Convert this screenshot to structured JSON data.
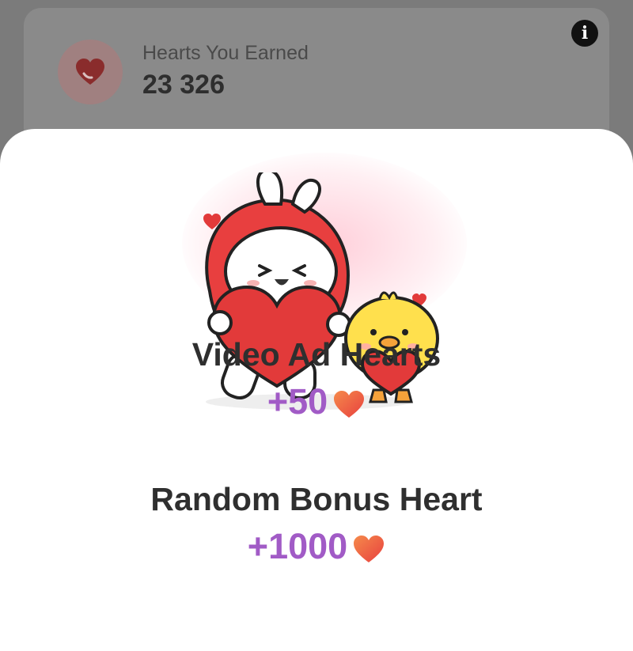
{
  "summary": {
    "title": "Hearts You Earned",
    "value": "23 326"
  },
  "colors": {
    "accent_purple": "#a15bc6",
    "heart_red": "#e8403f",
    "heart_orange": "#f58a4b"
  },
  "icons": {
    "info": "info-icon",
    "heart": "heart-icon"
  },
  "rewards": [
    {
      "title": "Video Ad Hearts",
      "amount": "+50"
    },
    {
      "title": "Random Bonus Heart",
      "amount": "+1000"
    }
  ]
}
